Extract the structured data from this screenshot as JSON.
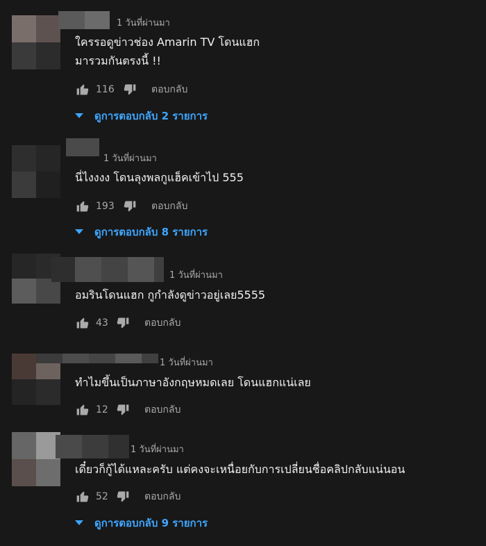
{
  "icons": {
    "like": "thumbs-up-icon",
    "dislike": "thumbs-down-icon",
    "expand": "caret-down-icon"
  },
  "colors": {
    "background": "#181818",
    "text": "#f1f1f1",
    "secondary": "#aaaaaa",
    "link": "#3ea6ff"
  },
  "reply_label": "ตอบกลับ",
  "comments": [
    {
      "time": "1 วันที่ผ่านมา",
      "text_lines": [
        "ใครรอดูข่าวช่อง Amarin TV โดนแฮก",
        "มารวมกันตรงนี้ !!"
      ],
      "likes": "116",
      "view_replies": "ดูการตอบกลับ 2 รายการ"
    },
    {
      "time": "1 วันที่ผ่านมา",
      "text_lines": [
        "นี่ไงงงง โดนลุงพลกูแฮ็คเข้าไป 555"
      ],
      "likes": "193",
      "view_replies": "ดูการตอบกลับ 8 รายการ"
    },
    {
      "time": "1 วันที่ผ่านมา",
      "text_lines": [
        "อมรินโดนแฮก กูกำลังดูข่าวอยู่เลย5555"
      ],
      "likes": "43"
    },
    {
      "time": "1 วันที่ผ่านมา",
      "text_lines": [
        "ทำไมขึ้นเป็นภาษาอังกฤษหมดเลย โดนแฮกแน่เลย"
      ],
      "likes": "12"
    },
    {
      "time": "1 วันที่ผ่านมา",
      "text_lines": [
        "เดี๋ยวก็กู้ได้แหละครับ แต่คงจะเหนื่อยกับการเปลี่ยนชื่อคลิปกลับแน่นอน"
      ],
      "likes": "52",
      "view_replies": "ดูการตอบกลับ 9 รายการ"
    }
  ]
}
